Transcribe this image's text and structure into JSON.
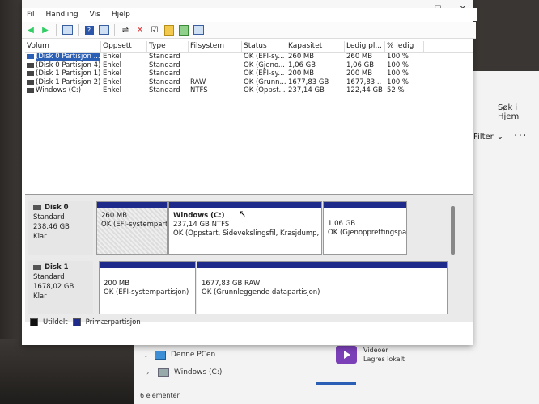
{
  "window": {
    "controls": {
      "minimize": "—",
      "maximize": "☐",
      "close": "✕"
    }
  },
  "menu": [
    "Fil",
    "Handling",
    "Vis",
    "Hjelp"
  ],
  "volume_list": {
    "columns": [
      "Volum",
      "Oppsett",
      "Type",
      "Filsystem",
      "Status",
      "Kapasitet",
      "Ledig pl...",
      "% ledig"
    ],
    "rows": [
      [
        "(Disk 0 Partisjon ...",
        "Enkel",
        "Standard",
        "",
        "OK (EFI-sy...",
        "260 MB",
        "260 MB",
        "100 %"
      ],
      [
        "(Disk 0 Partisjon 4)",
        "Enkel",
        "Standard",
        "",
        "OK (Gjeno...",
        "1,06 GB",
        "1,06 GB",
        "100 %"
      ],
      [
        "(Disk 1 Partisjon 1)",
        "Enkel",
        "Standard",
        "",
        "OK (EFI-sy...",
        "200 MB",
        "200 MB",
        "100 %"
      ],
      [
        "(Disk 1 Partisjon 2)",
        "Enkel",
        "Standard",
        "RAW",
        "OK (Grunn...",
        "1677,83 GB",
        "1677,83...",
        "100 %"
      ],
      [
        "Windows  (C:)",
        "Enkel",
        "Standard",
        "NTFS",
        "OK (Oppst...",
        "237,14 GB",
        "122,44 GB",
        "52 %"
      ]
    ]
  },
  "disks": [
    {
      "name": "Disk 0",
      "type": "Standard",
      "size": "238,46 GB",
      "state": "Klar",
      "partitions": [
        {
          "name": "",
          "size": "260 MB",
          "status": "OK (EFI-systempartisjon)"
        },
        {
          "name": "Windows   (C:)",
          "size": "237,14 GB NTFS",
          "status": "OK (Oppstart, Sidevekslingsfil, Krasjdump, Grunnleggende datapartisjon)"
        },
        {
          "name": "",
          "size": "1,06 GB",
          "status": "OK (Gjenopprettingspartisjon)"
        }
      ]
    },
    {
      "name": "Disk 1",
      "type": "Standard",
      "size": "1678,02 GB",
      "state": "Klar",
      "partitions": [
        {
          "name": "",
          "size": "200 MB",
          "status": "OK (EFI-systempartisjon)"
        },
        {
          "name": "",
          "size": "1677,83 GB RAW",
          "status": "OK (Grunnleggende datapartisjon)"
        }
      ]
    }
  ],
  "legend": [
    "Utildelt",
    "Primærpartisjon"
  ],
  "explorer": {
    "search": "Søk i Hjem",
    "filter": "Filter",
    "more": "···",
    "nav": [
      "Denne PCen",
      "Windows (C:)"
    ],
    "folder_name": "Videoer",
    "folder_status": "Lagres lokalt",
    "item_count": "6 elementer"
  },
  "colors": {
    "primary_partition": "#1f2b8a",
    "unallocated": "#111111"
  }
}
